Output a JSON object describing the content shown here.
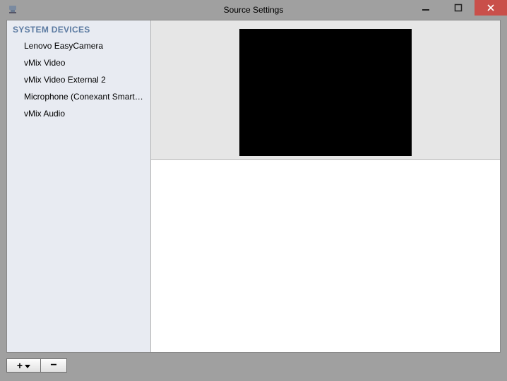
{
  "window": {
    "title": "Source Settings"
  },
  "sidebar": {
    "header": "SYSTEM DEVICES",
    "items": [
      {
        "label": "Lenovo EasyCamera"
      },
      {
        "label": "vMix Video"
      },
      {
        "label": "vMix Video External 2"
      },
      {
        "label": "Microphone (Conexant SmartAudio)"
      },
      {
        "label": "vMix Audio"
      }
    ]
  },
  "buttons": {
    "add": "+",
    "remove": "−"
  }
}
